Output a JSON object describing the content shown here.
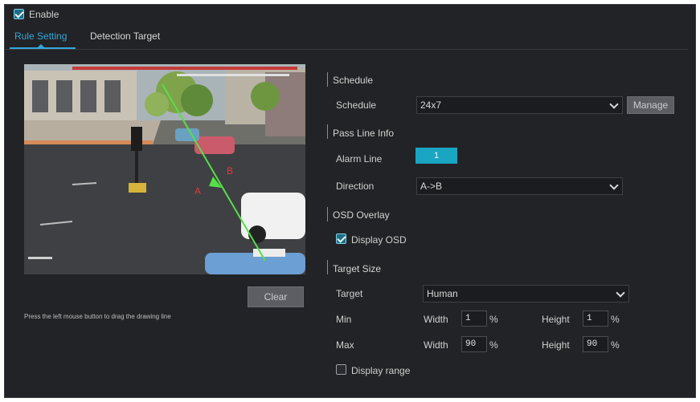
{
  "enable": {
    "label": "Enable",
    "checked": true
  },
  "tabs": [
    {
      "label": "Rule Setting",
      "active": true
    },
    {
      "label": "Detection Target",
      "active": false
    }
  ],
  "video": {
    "line_label_a": "A",
    "line_label_b": "B"
  },
  "clear_button": "Clear",
  "hint": "Press the left mouse button to drag the drawing line",
  "schedule": {
    "section_title": "Schedule",
    "label": "Schedule",
    "value": "24x7",
    "manage_button": "Manage"
  },
  "pass_line": {
    "section_title": "Pass Line Info",
    "alarm_line_label": "Alarm Line",
    "alarm_line_value": "1",
    "direction_label": "Direction",
    "direction_value": "A->B"
  },
  "osd": {
    "section_title": "OSD Overlay",
    "display_osd_label": "Display OSD",
    "display_osd_checked": true
  },
  "target_size": {
    "section_title": "Target Size",
    "target_label": "Target",
    "target_value": "Human",
    "min_label": "Min",
    "max_label": "Max",
    "width_label": "Width",
    "height_label": "Height",
    "min_width": "1",
    "min_height": "1",
    "max_width": "90",
    "max_height": "90",
    "percent": "%",
    "display_range_label": "Display range",
    "display_range_checked": false
  },
  "colors": {
    "accent": "#34a7d9",
    "alarm_button": "#1aa5c2",
    "panel_bg": "#222326"
  }
}
